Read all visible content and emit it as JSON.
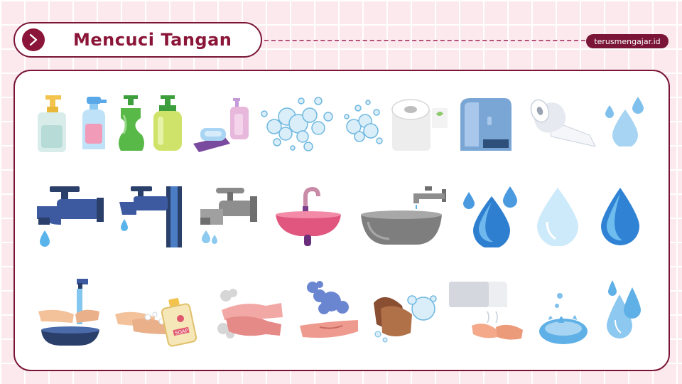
{
  "header": {
    "title": "Mencuci Tangan",
    "brand": "terusmengajar.id",
    "arrow_icon": "chevron-right-icon"
  },
  "colors": {
    "accent": "#7a1538",
    "background": "#fbe9ee",
    "card": "#ffffff"
  },
  "gallery": {
    "rows": [
      [
        "soap-pump-bottle-icon",
        "spray-bottle-icon",
        "green-soap-bottle-icon",
        "yellow-soap-bottle-icon",
        "soap-bar-and-pump-icon",
        "soap-bubbles-icon",
        "small-bubbles-icon",
        "toilet-paper-roll-icon",
        "hand-dryer-icon",
        "paper-towel-roll-icon",
        "water-drops-icon"
      ],
      [
        "dark-faucet-icon",
        "wall-faucet-icon",
        "gray-faucet-icon",
        "pink-sink-icon",
        "gray-basin-faucet-icon",
        "water-drops-blue-icon",
        "light-water-drop-icon",
        "blue-water-drop-icon"
      ],
      [
        "washing-hands-basin-icon",
        "hands-with-soap-bottle-icon",
        "hands-scrubbing-icon",
        "hand-with-foam-icon",
        "hands-with-bubbles-icon",
        "hands-under-dryer-icon",
        "water-splash-icon",
        "falling-drops-icon"
      ]
    ]
  }
}
